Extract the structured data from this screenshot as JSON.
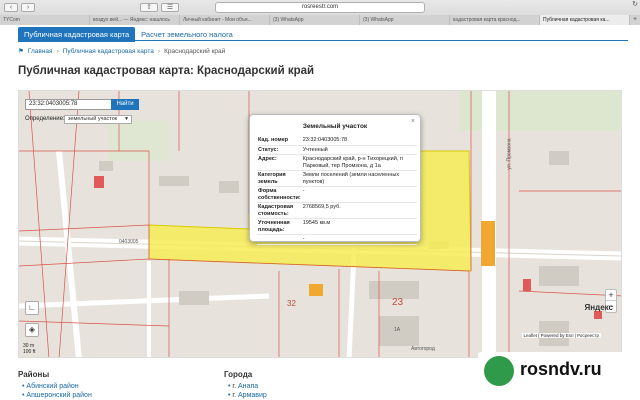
{
  "browser": {
    "url": "rosreestr.com",
    "tabs": [
      "TYCom",
      "воздух вей... — Яндекс: нашлось",
      "Личный кабинет - Мои объя...",
      "(3) WhatsApp",
      "(3) WhatsApp",
      "кадастровая карта краснод...",
      "Публичная кадастровая ка..."
    ],
    "active_tab": 6
  },
  "site_nav": [
    "Публичная кадастровая карта",
    "Расчет земельного налога"
  ],
  "breadcrumbs": [
    "Главная",
    "Публичная кадастровая карта",
    "Краснодарский край"
  ],
  "page_title": "Публичная кадастровая карта: Краснодарский край",
  "map": {
    "search_value": "23:32:0403005:78",
    "search_button": "Найти",
    "definition_label": "Определение:",
    "definition_value": "земельный участок",
    "popup": {
      "title": "Земельный участок",
      "rows": [
        {
          "k": "Кад. номер",
          "v": "23:32:0403005:78"
        },
        {
          "k": "Статус:",
          "v": "Учтенный"
        },
        {
          "k": "Адрес:",
          "v": "Краснодарский край, р-н Тихорецкий, п Парковый, тер Промзона, д 1а"
        },
        {
          "k": "Категория земель",
          "v": "Земли поселений (земли населенных пунктов)"
        },
        {
          "k": "Форма собственности:",
          "v": "-"
        },
        {
          "k": "Кадастровая стоимость:",
          "v": "2768569,5 руб."
        },
        {
          "k": "Уточненная площадь:",
          "v": "19545 кв.м"
        },
        {
          "k": "",
          "v": "-"
        }
      ]
    },
    "labels": {
      "quarter_23": "23",
      "quarter_32": "32",
      "plot_id": "0403005",
      "street": "ул. Промзона",
      "bus": "Автогород",
      "label_1a": "1А",
      "yandex": "Яндекс",
      "attribution": "Leaflet | Powered by Esri | Росреестр",
      "scale_m": "30 m",
      "scale_ft": "100 ft"
    }
  },
  "sections": {
    "regions_title": "Районы",
    "regions": [
      "Абинский район",
      "Апшеронский район"
    ],
    "cities_title": "Города",
    "cities": [
      {
        "prefix": "г.",
        "name": "Анапа"
      },
      {
        "prefix": "г.",
        "name": "Армавир"
      }
    ]
  },
  "watermark": "rosndv.ru"
}
